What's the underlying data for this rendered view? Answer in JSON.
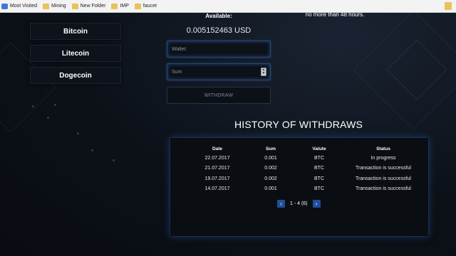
{
  "bookmarks": {
    "items": [
      {
        "label": "Most Visited",
        "icon": "most-visited-icon"
      },
      {
        "label": "Mining",
        "icon": "folder-icon"
      },
      {
        "label": "New Folder",
        "icon": "folder-icon"
      },
      {
        "label": "IMP",
        "icon": "folder-icon"
      },
      {
        "label": "faucet",
        "icon": "folder-icon"
      }
    ]
  },
  "coins": [
    "Bitcoin",
    "Litecoin",
    "Dogecoin"
  ],
  "wallet": {
    "available_label": "Available:",
    "balance": "0.005152463 USD",
    "note": "no more than 48 hours.",
    "wallet_placeholder": "Wallet:",
    "sum_placeholder": "Sum",
    "withdraw_label": "WITHDRAW"
  },
  "history": {
    "title": "HISTORY OF WITHDRAWS",
    "headers": [
      "Date",
      "Sum",
      "Valute",
      "Status"
    ],
    "rows": [
      [
        "22.07.2017",
        "0.001",
        "BTC",
        "In progress"
      ],
      [
        "21.07.2017",
        "0.002",
        "BTC",
        "Transaction is successful"
      ],
      [
        "19.07.2017",
        "0.002",
        "BTC",
        "Transaction is successful"
      ],
      [
        "14.07.2017",
        "0.001",
        "BTC",
        "Transaction is successful"
      ]
    ],
    "pager_text": "1 - 4 (6)"
  },
  "colors": {
    "accent": "#1f4f9a",
    "glow": "#285aaa",
    "background": "#0b0f16"
  }
}
